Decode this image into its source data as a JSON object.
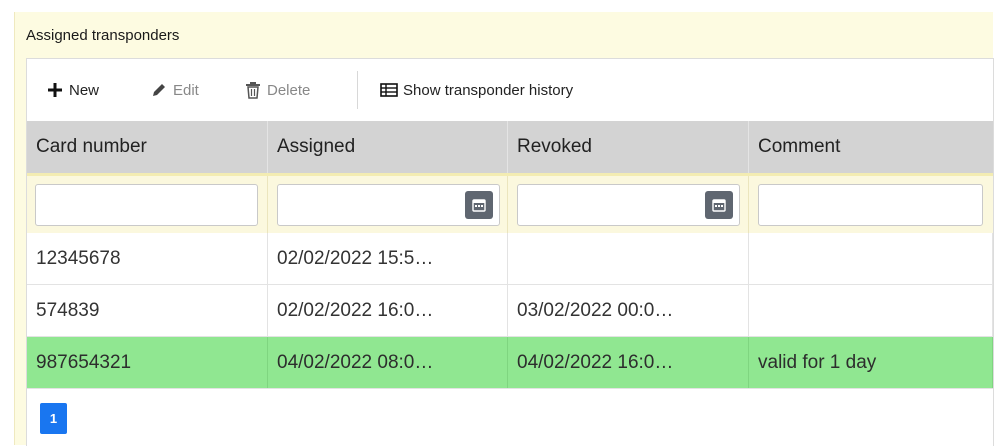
{
  "panel": {
    "title": "Assigned transponders"
  },
  "toolbar": {
    "new_label": "New",
    "edit_label": "Edit",
    "delete_label": "Delete",
    "history_label": "Show transponder history"
  },
  "columns": [
    "Card number",
    "Assigned",
    "Revoked",
    "Comment"
  ],
  "rows": [
    {
      "card": "12345678",
      "assigned": "02/02/2022 15:5…",
      "revoked": "",
      "comment": ""
    },
    {
      "card": "574839",
      "assigned": "02/02/2022 16:0…",
      "revoked": "03/02/2022 00:0…",
      "comment": ""
    },
    {
      "card": "987654321",
      "assigned": "04/02/2022 08:0…",
      "revoked": "04/02/2022 16:0…",
      "comment": "valid for 1 day"
    }
  ],
  "pager": {
    "current_page": "1"
  },
  "colors": {
    "selected_row": "#90e791",
    "header": "#d3d3d3",
    "pager": "#1976f0",
    "panel_bg": "#fdfbe1"
  }
}
